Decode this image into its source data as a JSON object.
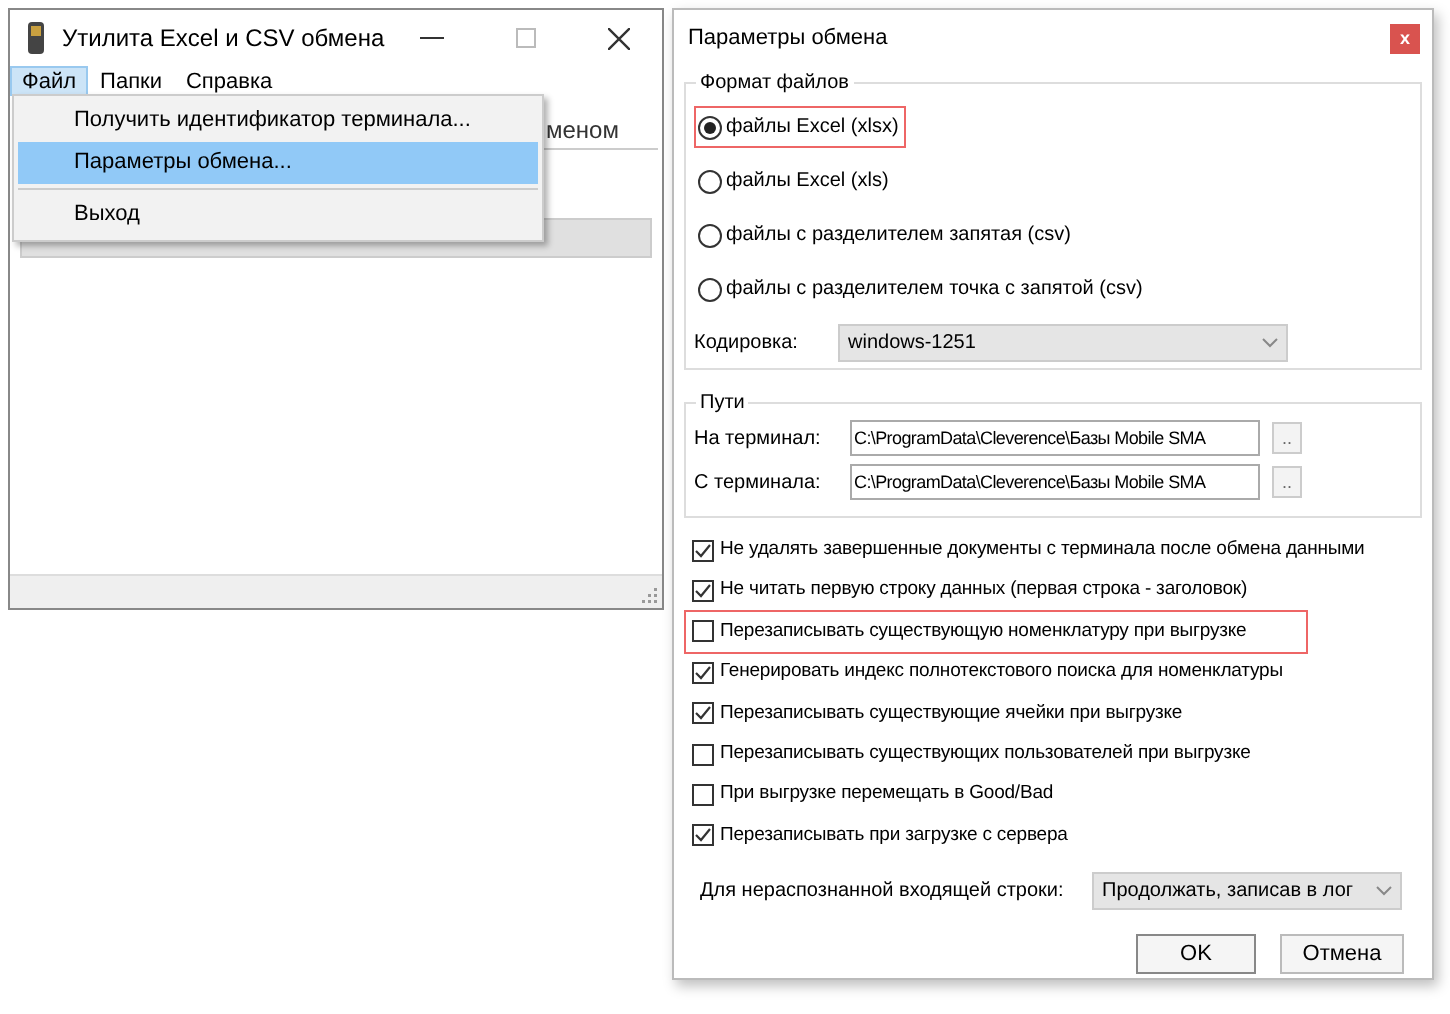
{
  "main_window": {
    "title": "Утилита Excel и CSV обмена",
    "menu": [
      {
        "label": "Файл",
        "selected": true
      },
      {
        "label": "Папки",
        "selected": false
      },
      {
        "label": "Справка",
        "selected": false
      }
    ],
    "hidden_text": "меном"
  },
  "file_menu": {
    "items": [
      {
        "kind": "command",
        "label": "Получить идентификатор терминала...",
        "selected": false
      },
      {
        "kind": "command",
        "label": "Параметры обмена...",
        "selected": true
      },
      {
        "kind": "separator"
      },
      {
        "kind": "command",
        "label": "Выход",
        "selected": false
      }
    ]
  },
  "dialog": {
    "title": "Параметры обмена",
    "close": "x",
    "format_group": {
      "title": "Формат файлов",
      "options": [
        {
          "label": "файлы Excel (xlsx)",
          "selected": true,
          "highlighted": true
        },
        {
          "label": "файлы Excel (xls)",
          "selected": false,
          "highlighted": false
        },
        {
          "label": "файлы с разделителем запятая (csv)",
          "selected": false,
          "highlighted": false
        },
        {
          "label": "файлы с разделителем точка с запятой (csv)",
          "selected": false,
          "highlighted": false
        }
      ],
      "encoding_label": "Кодировка:",
      "encoding_value": "windows-1251"
    },
    "paths_group": {
      "title": "Пути",
      "rows": [
        {
          "label": "На терминал:",
          "value": "C:\\ProgramData\\Cleverence\\Базы Mobile SMA",
          "browse": ".."
        },
        {
          "label": "С терминала:",
          "value": "C:\\ProgramData\\Cleverence\\Базы Mobile SMA",
          "browse": ".."
        }
      ]
    },
    "checkboxes": [
      {
        "label": "Не удалять завершенные документы с терминала после обмена данными",
        "checked": true,
        "highlighted": false
      },
      {
        "label": "Не читать первую строку данных (первая строка - заголовок)",
        "checked": true,
        "highlighted": false
      },
      {
        "label": "Перезаписывать существующую номенклатуру при выгрузке",
        "checked": false,
        "highlighted": true
      },
      {
        "label": "Генерировать индекс полнотекстового поиска для номенклатуры",
        "checked": true,
        "highlighted": false
      },
      {
        "label": "Перезаписывать существующие ячейки при выгрузке",
        "checked": true,
        "highlighted": false
      },
      {
        "label": "Перезаписывать существующих пользователей при выгрузке",
        "checked": false,
        "highlighted": false
      },
      {
        "label": "При выгрузке перемещать в Good/Bad",
        "checked": false,
        "highlighted": false
      },
      {
        "label": "Перезаписывать при загрузке с сервера",
        "checked": true,
        "highlighted": false
      }
    ],
    "unrecognized_label": "Для нераспознанной входящей строки:",
    "unrecognized_value": "Продолжать, записав в лог",
    "buttons": [
      "OK",
      "Отмена"
    ]
  }
}
